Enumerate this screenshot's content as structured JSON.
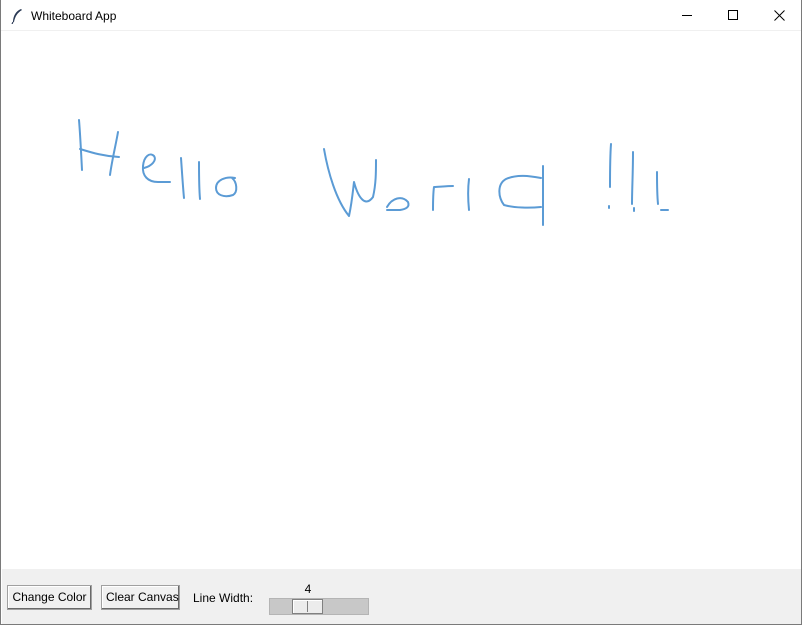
{
  "window": {
    "title": "Whiteboard App",
    "controls": {
      "minimize_icon": "minimize-icon",
      "maximize_icon": "maximize-icon",
      "close_icon": "close-icon"
    }
  },
  "canvas": {
    "background": "#ffffff",
    "stroke_color": "#5b9bd5",
    "handwritten_text": "Hello World !!!"
  },
  "toolbar": {
    "background": "#f0f0f0",
    "change_color_label": "Change Color",
    "clear_canvas_label": "Clear Canvas",
    "line_width_label": "Line Width:",
    "line_width_value": "4"
  }
}
